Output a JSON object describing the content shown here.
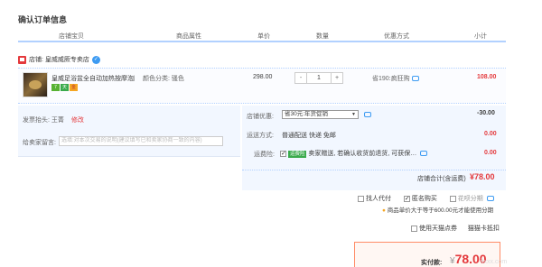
{
  "page": {
    "title": "确认订单信息"
  },
  "table_header": {
    "store": "店铺宝贝",
    "attrs": "商品属性",
    "price": "单价",
    "qty": "数量",
    "promo": "优惠方式",
    "subtotal": "小计"
  },
  "shop": {
    "label": "店铺: 皇威威厥专卖店"
  },
  "item": {
    "title": "皇威足浴盆全自动加热按摩泡脚…",
    "badges": [
      "7",
      "天",
      "金"
    ],
    "sku": "颜色分类: 骚色",
    "price": "298.00",
    "qty": "1",
    "qty_minus": "-",
    "qty_plus": "+",
    "promo": "省190:疯狂购",
    "subtotal": "108.00"
  },
  "invoice": {
    "label": "发票抬头: 王菁",
    "edit": "修改"
  },
  "message": {
    "label": "给卖家留言:",
    "placeholder": "选填:对本次交易的说明(建议填写已和卖家协商一致的内容)"
  },
  "discount": {
    "label": "店铺优惠:",
    "selected": "省30元:年货促销",
    "amount": "-30.00"
  },
  "shipping": {
    "label": "运送方式:",
    "value": "普通配送 快递 免邮",
    "amount": "0.00"
  },
  "insurance": {
    "label": "运费险:",
    "tag": "运费险",
    "text": "卖家赠送, 若确认收货前退货, 可获保…",
    "amount": "0.00"
  },
  "store_total": {
    "label": "店铺合计(含运费)",
    "amount": "¥78.00"
  },
  "options": {
    "proxy": "找人代付",
    "anonymous": "匿名购买",
    "huabei": "花呗分期",
    "huabei_note": "商品单价大于等于600.00元才能使用分期"
  },
  "tmall_points": {
    "label": "使用天猫点券",
    "link": "猫猫卡抵扣"
  },
  "payment": {
    "label": "实付款:",
    "currency": "¥",
    "amount": "78.00"
  },
  "watermark": "itxxx.com"
}
